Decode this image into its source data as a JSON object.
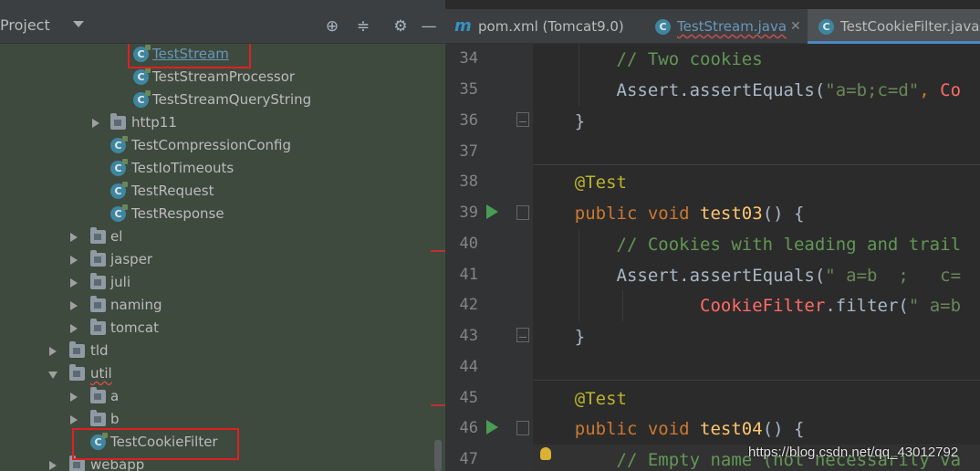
{
  "project_panel": {
    "title": "Project",
    "tree": [
      {
        "label": "TestStream",
        "type": "class",
        "link": true
      },
      {
        "label": "TestStreamProcessor",
        "type": "class"
      },
      {
        "label": "TestStreamQueryString",
        "type": "class"
      },
      {
        "label": "http11",
        "type": "package",
        "expanded": false
      },
      {
        "label": "TestCompressionConfig",
        "type": "class"
      },
      {
        "label": "TestIoTimeouts",
        "type": "class"
      },
      {
        "label": "TestRequest",
        "type": "class"
      },
      {
        "label": "TestResponse",
        "type": "class"
      },
      {
        "label": "el",
        "type": "package",
        "expanded": false
      },
      {
        "label": "jasper",
        "type": "package",
        "expanded": false
      },
      {
        "label": "juli",
        "type": "package",
        "expanded": false
      },
      {
        "label": "naming",
        "type": "package",
        "expanded": false
      },
      {
        "label": "tomcat",
        "type": "package",
        "expanded": false
      },
      {
        "label": "tld",
        "type": "package",
        "expanded": false
      },
      {
        "label": "util",
        "type": "package",
        "expanded": true
      },
      {
        "label": "a",
        "type": "package",
        "expanded": false
      },
      {
        "label": "b",
        "type": "package",
        "expanded": false
      },
      {
        "label": "TestCookieFilter",
        "type": "class"
      },
      {
        "label": "webapp",
        "type": "package",
        "expanded": false
      }
    ]
  },
  "tabs": [
    {
      "label": "pom.xml (Tomcat9.0)",
      "icon": "maven-icon"
    },
    {
      "label": "TestStream.java",
      "icon": "java-class-icon"
    },
    {
      "label": "TestCookieFilter.java",
      "icon": "java-class-icon",
      "active": true
    }
  ],
  "editor": {
    "line_numbers": [
      "34",
      "35",
      "36",
      "37",
      "38",
      "39",
      "40",
      "41",
      "42",
      "43",
      "44",
      "45",
      "46",
      "47"
    ],
    "lines": {
      "l34": {
        "comment": "// Two cookies"
      },
      "l35": {
        "a": "Assert.assertEquals(",
        "b": "\"a=b;c=d\"",
        "c": ", ",
        "d": "Co"
      },
      "l36": {
        "a": "}"
      },
      "l38": {
        "a": "@Test"
      },
      "l39": {
        "a": "public void ",
        "b": "test03",
        "c": "() {"
      },
      "l40": {
        "comment": "// Cookies with leading and trail"
      },
      "l41": {
        "a": "Assert.assertEquals(",
        "b": "\" a=b  ;   c="
      },
      "l42": {
        "a": "CookieFilter",
        "b": ".filter(",
        "c": "\" a=b"
      },
      "l43": {
        "a": "}"
      },
      "l45": {
        "a": "@Test"
      },
      "l46": {
        "a": "public void ",
        "b": "test04",
        "c": "() {"
      },
      "l47": {
        "comment": "// Empty name (not necessarily va"
      }
    }
  },
  "watermark": "https://blog.csdn.net/qq_43012792",
  "colors": {
    "highlight_box": "#e02020",
    "keyword": "#cc7832",
    "comment": "#629755",
    "string": "#6a8759"
  }
}
